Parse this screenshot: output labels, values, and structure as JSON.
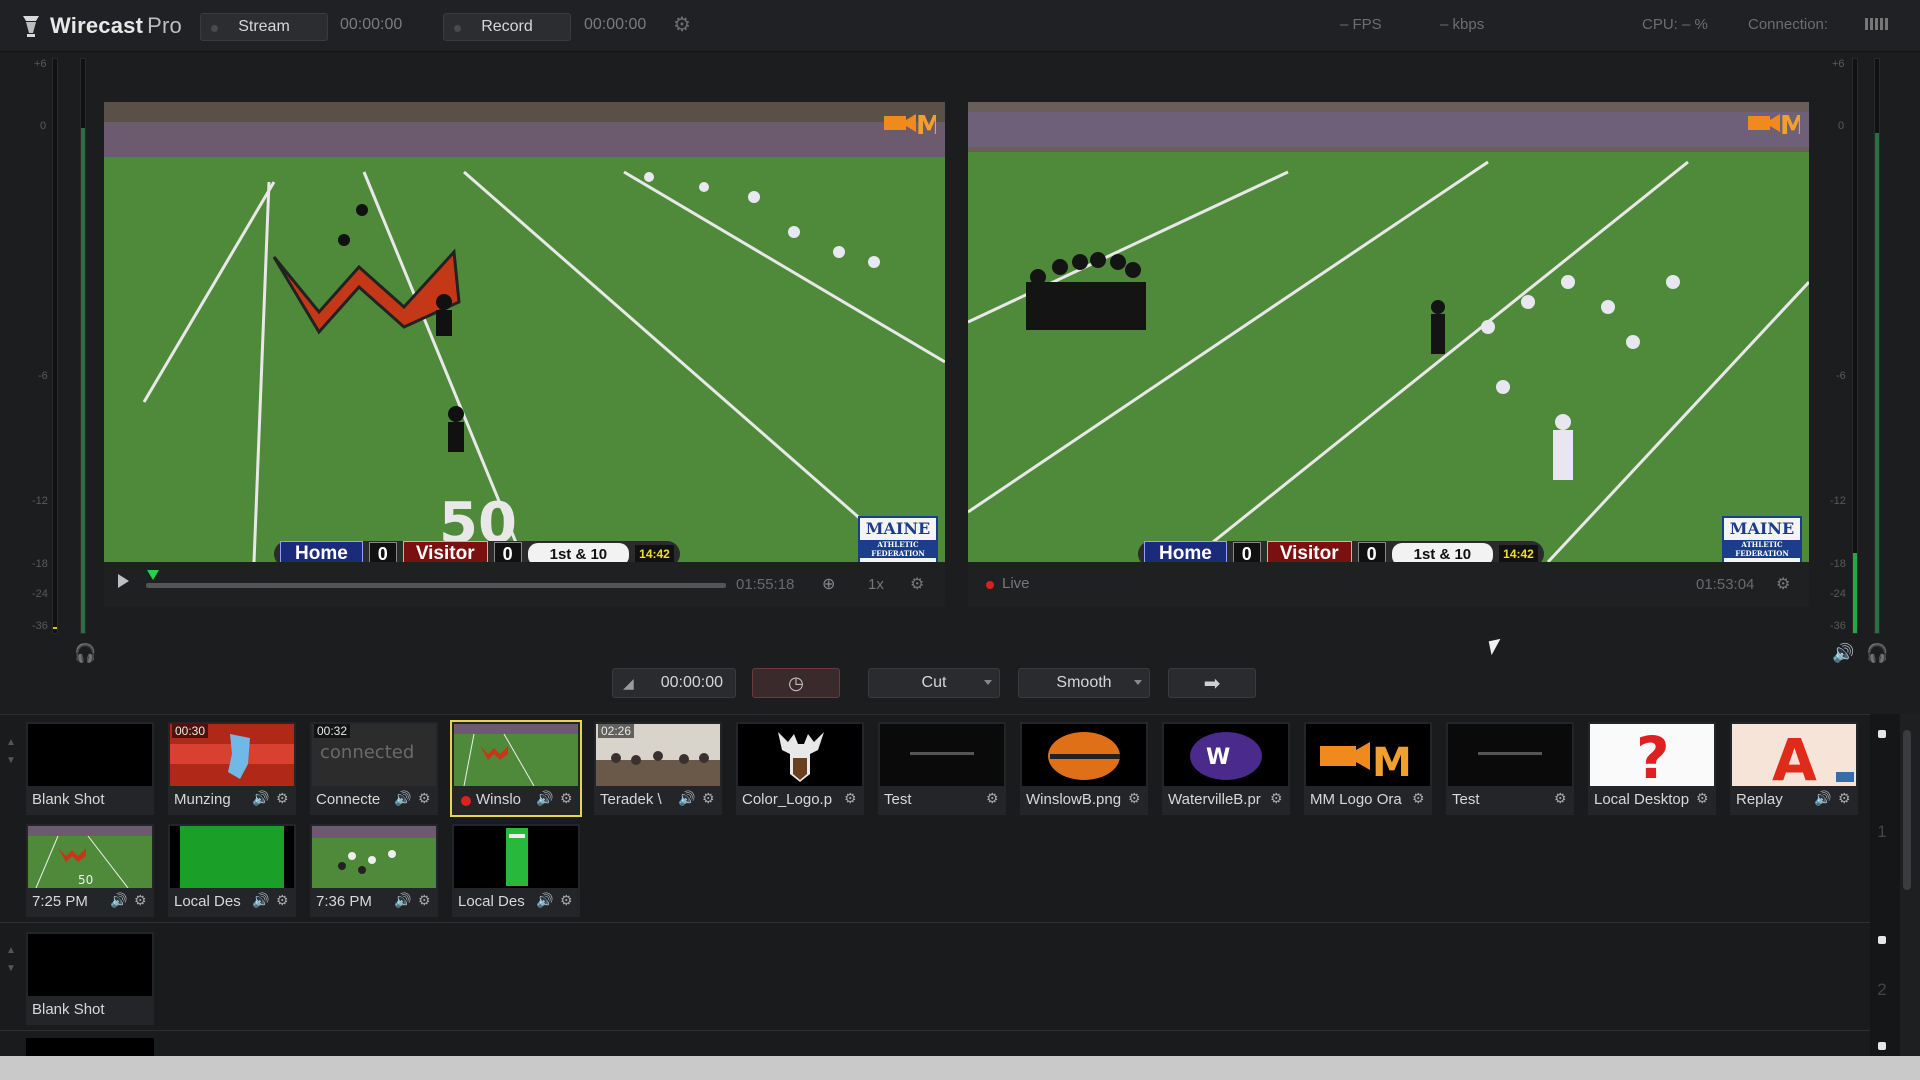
{
  "app": {
    "name": "Wirecast",
    "edition": "Pro"
  },
  "toolbar": {
    "stream_label": "Stream",
    "stream_time": "00:00:00",
    "record_label": "Record",
    "record_time": "00:00:00",
    "fps": "– FPS",
    "kbps": "– kbps",
    "cpu": "CPU:   – %",
    "connection": "Connection:"
  },
  "meter_scale": [
    "+6",
    "0",
    "-6",
    "-12",
    "-18",
    "-24",
    "-36"
  ],
  "preview": {
    "time": "01:55:18",
    "speed": "1x"
  },
  "live": {
    "status": "Live",
    "time": "01:53:04"
  },
  "scoreboard": {
    "home": "Home",
    "home_score": "0",
    "visitor": "Visitor",
    "visitor_score": "0",
    "down": "1st & 10",
    "clock": "14:42"
  },
  "badges": {
    "maine": "MAINE",
    "maine_sub": "ATHLETIC FEDERATION",
    "mm": "M"
  },
  "transition": {
    "time": "00:00:00",
    "cut": "Cut",
    "smooth": "Smooth"
  },
  "layers": [
    "1",
    "2"
  ],
  "shots_row1": [
    {
      "label": "Blank Shot",
      "dur": "",
      "audio": false,
      "gear": false
    },
    {
      "label": "Munzing",
      "dur": "00:30",
      "audio": true,
      "gear": true
    },
    {
      "label": "Connecte",
      "dur": "00:32",
      "audio": true,
      "gear": true
    },
    {
      "label": "Winslo",
      "dur": "",
      "audio": true,
      "gear": true
    },
    {
      "label": "Teradek \\",
      "dur": "02:26",
      "audio": true,
      "gear": true
    },
    {
      "label": "Color_Logo.p",
      "dur": "",
      "audio": false,
      "gear": true
    },
    {
      "label": "Test",
      "dur": "",
      "audio": false,
      "gear": true
    },
    {
      "label": "WinslowB.png",
      "dur": "",
      "audio": false,
      "gear": true
    },
    {
      "label": "WatervilleB.pr",
      "dur": "",
      "audio": false,
      "gear": true
    },
    {
      "label": "MM Logo Ora",
      "dur": "",
      "audio": false,
      "gear": true
    },
    {
      "label": "Test",
      "dur": "",
      "audio": false,
      "gear": true
    },
    {
      "label": "Local Desktop",
      "dur": "",
      "audio": false,
      "gear": true
    },
    {
      "label": "Replay",
      "dur": "",
      "audio": true,
      "gear": true
    }
  ],
  "shots_row2": [
    {
      "label": "7:25 PM",
      "audio": true,
      "gear": true
    },
    {
      "label": "Local Des",
      "audio": true,
      "gear": true
    },
    {
      "label": "7:36 PM",
      "audio": true,
      "gear": true
    },
    {
      "label": "Local Des",
      "audio": true,
      "gear": true
    }
  ],
  "shots_layer2": [
    {
      "label": "Blank Shot"
    }
  ],
  "colors": {
    "accent_select": "#e8d64a",
    "meter": "#1ea94a",
    "live": "#d82020",
    "field": "#4f8a3a"
  }
}
